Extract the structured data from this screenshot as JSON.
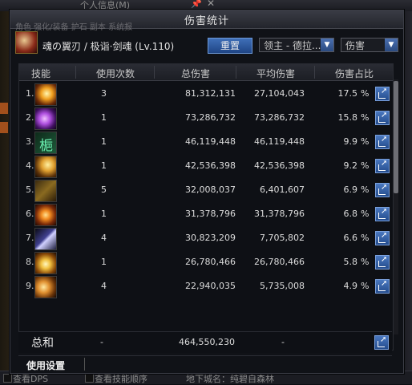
{
  "background": {
    "title": "个人信息(M)",
    "tabs_ghost": "角色   强化/装备   护石   副本   系统报",
    "bottom_items": [
      "查看DPS",
      "查看技能顺序",
      "地下城名：纯碧自森林"
    ]
  },
  "window": {
    "title": "伤害统计",
    "character_name": "魂の翼刃 / 极诣·剑魂 (Lv.110)",
    "reset_button": "重置",
    "target_dropdown": "领主 - 德拉...",
    "metric_dropdown": "伤害",
    "dropdown_arrow": "▼"
  },
  "table": {
    "headers": [
      "技能",
      "使用次数",
      "总伤害",
      "平均伤害",
      "伤害占比"
    ],
    "rows": [
      {
        "index": "1.",
        "uses": "3",
        "total": "81,312,131",
        "average": "27,104,043",
        "share": "17.5",
        "icon": "skill-icon-1"
      },
      {
        "index": "2.",
        "uses": "1",
        "total": "73,286,732",
        "average": "73,286,732",
        "share": "15.8",
        "icon": "skill-icon-2"
      },
      {
        "index": "3.",
        "uses": "1",
        "total": "46,119,448",
        "average": "46,119,448",
        "share": "9.9",
        "icon": "skill-icon-3"
      },
      {
        "index": "4.",
        "uses": "1",
        "total": "42,536,398",
        "average": "42,536,398",
        "share": "9.2",
        "icon": "skill-icon-4"
      },
      {
        "index": "5.",
        "uses": "5",
        "total": "32,008,037",
        "average": "6,401,607",
        "share": "6.9",
        "icon": "skill-icon-5"
      },
      {
        "index": "6.",
        "uses": "1",
        "total": "31,378,796",
        "average": "31,378,796",
        "share": "6.8",
        "icon": "skill-icon-6"
      },
      {
        "index": "7.",
        "uses": "4",
        "total": "30,823,209",
        "average": "7,705,802",
        "share": "6.6",
        "icon": "skill-icon-7"
      },
      {
        "index": "8.",
        "uses": "1",
        "total": "26,780,466",
        "average": "26,780,466",
        "share": "5.8",
        "icon": "skill-icon-8"
      },
      {
        "index": "9.",
        "uses": "4",
        "total": "22,940,035",
        "average": "5,735,008",
        "share": "4.9",
        "icon": "skill-icon-9"
      }
    ],
    "percent_sign": "%"
  },
  "total": {
    "label": "总和",
    "uses": "-",
    "total": "464,550,230",
    "average": "-"
  },
  "footer": {
    "settings_label": "使用设置"
  }
}
